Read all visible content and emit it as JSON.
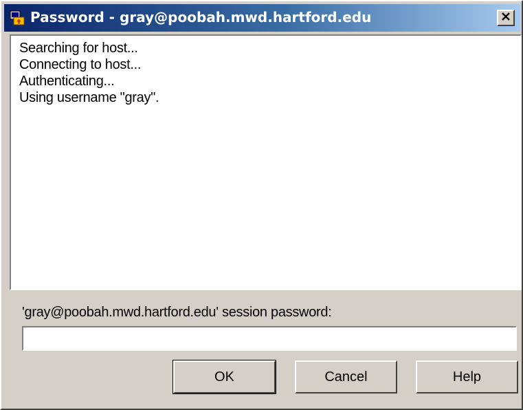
{
  "window": {
    "title": "Password - gray@poobah.mwd.hartford.edu"
  },
  "log": {
    "lines": [
      "Searching for host...",
      "Connecting to host...",
      "Authenticating...",
      "Using username \"gray\"."
    ]
  },
  "prompt": {
    "label": "'gray@poobah.mwd.hartford.edu' session password:",
    "value": ""
  },
  "buttons": {
    "ok": "OK",
    "cancel": "Cancel",
    "help": "Help"
  },
  "icons": {
    "app": "terminal-key-icon",
    "close": "close-icon"
  },
  "colors": {
    "titlebar_start": "#0a246a",
    "titlebar_end": "#a6caf0",
    "face": "#d4d0c8"
  }
}
